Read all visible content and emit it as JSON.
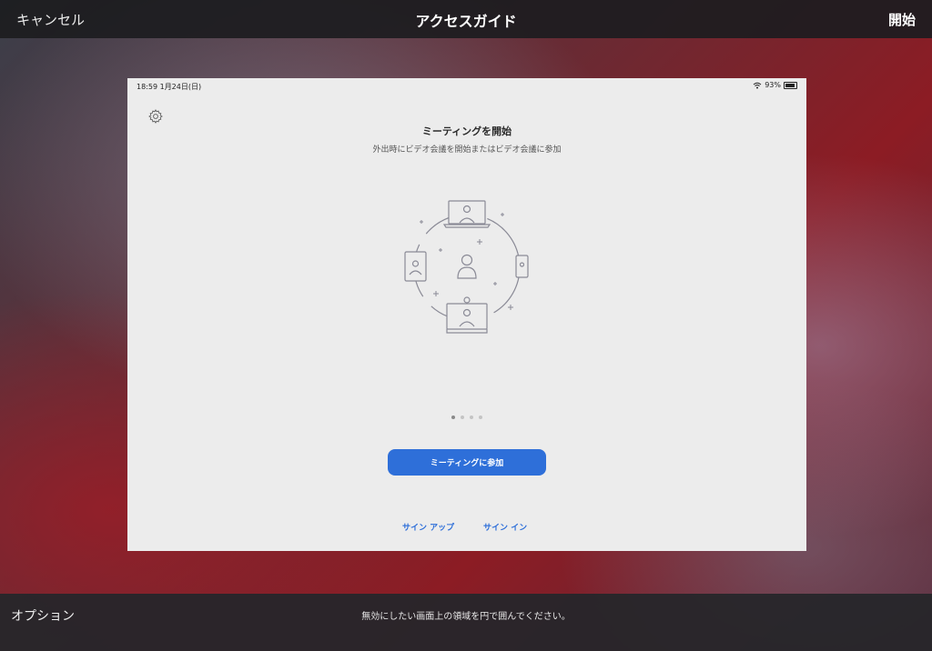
{
  "topbar": {
    "cancel_label": "キャンセル",
    "title": "アクセスガイド",
    "start_label": "開始"
  },
  "device": {
    "status_time": "18:59  1月24日(日)",
    "battery_text": "93%"
  },
  "app": {
    "headline": "ミーティングを開始",
    "subline": "外出時にビデオ会議を開始またはビデオ会議に参加",
    "pager": {
      "pages": 4,
      "active": 1
    },
    "join_button_label": "ミーティングに参加",
    "sign_up_label": "サイン アップ",
    "sign_in_label": "サイン イン",
    "accent_color": "#2e6fd9"
  },
  "bottombar": {
    "options_label": "オプション",
    "hint": "無効にしたい画面上の領域を円で囲んでください。"
  }
}
